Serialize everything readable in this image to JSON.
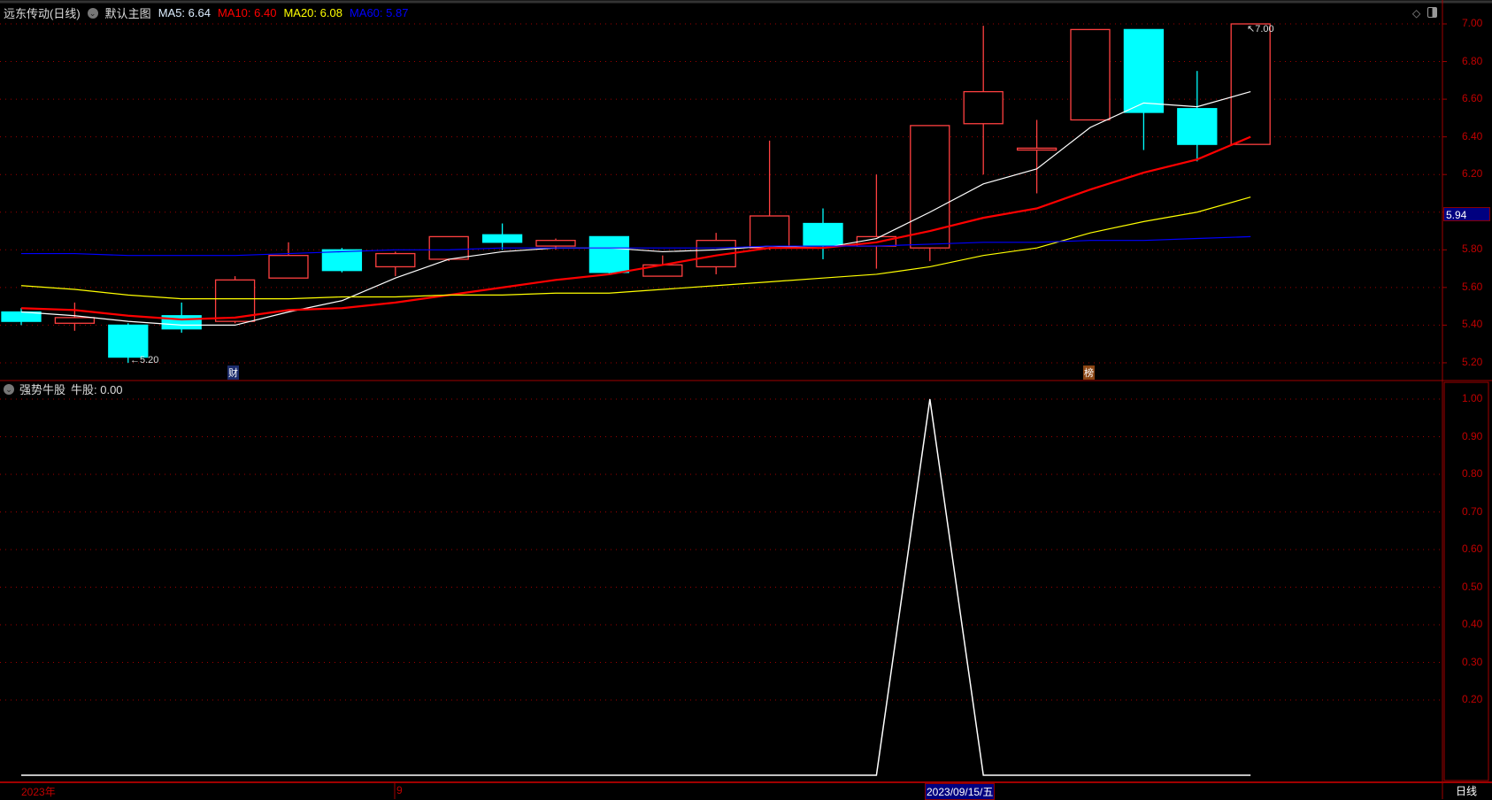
{
  "header": {
    "stock_title": "远东传动(日线)",
    "main_chart_label": "默认主图",
    "ma5": "MA5: 6.64",
    "ma10": "MA10: 6.40",
    "ma20": "MA20: 6.08",
    "ma60": "MA60: 5.87"
  },
  "indicator": {
    "name": "强势牛股",
    "value_label": "牛股: 0.00"
  },
  "colors": {
    "up": "#ff4040",
    "down": "#00ffff",
    "ma5": "#ffffff",
    "ma10": "#ff0000",
    "ma20": "#ffff00",
    "ma60": "#0000ff",
    "axis": "#c00000"
  },
  "price_axis": {
    "ticks": [
      "7.00",
      "6.80",
      "6.60",
      "6.40",
      "6.20",
      "6.00",
      "5.80",
      "5.60",
      "5.40",
      "5.20"
    ],
    "current_price": "5.94"
  },
  "indicator_axis": {
    "ticks": [
      "1.00",
      "0.90",
      "0.80",
      "0.70",
      "0.60",
      "0.50",
      "0.40",
      "0.30",
      "0.20"
    ]
  },
  "annotations": {
    "low_marker": "5.20",
    "high_marker": "7.00",
    "event_cai": "财",
    "event_bang": "榜"
  },
  "date_axis": {
    "year_label": "2023年",
    "month_label": "9",
    "selected_date": "2023/09/15/五",
    "period": "日线"
  },
  "chart_data": [
    {
      "type": "candlestick",
      "title": "远东传动(日线)",
      "ylim": [
        5.15,
        7.05
      ],
      "candles": [
        {
          "o": 5.47,
          "h": 5.49,
          "l": 5.4,
          "c": 5.42
        },
        {
          "o": 5.41,
          "h": 5.52,
          "l": 5.37,
          "c": 5.44
        },
        {
          "o": 5.4,
          "h": 5.41,
          "l": 5.2,
          "c": 5.23
        },
        {
          "o": 5.45,
          "h": 5.52,
          "l": 5.36,
          "c": 5.38
        },
        {
          "o": 5.42,
          "h": 5.66,
          "l": 5.41,
          "c": 5.64
        },
        {
          "o": 5.65,
          "h": 5.84,
          "l": 5.65,
          "c": 5.77
        },
        {
          "o": 5.8,
          "h": 5.81,
          "l": 5.68,
          "c": 5.69
        },
        {
          "o": 5.71,
          "h": 5.79,
          "l": 5.66,
          "c": 5.78
        },
        {
          "o": 5.75,
          "h": 5.87,
          "l": 5.74,
          "c": 5.87
        },
        {
          "o": 5.88,
          "h": 5.94,
          "l": 5.8,
          "c": 5.84
        },
        {
          "o": 5.82,
          "h": 5.86,
          "l": 5.8,
          "c": 5.85
        },
        {
          "o": 5.87,
          "h": 5.87,
          "l": 5.67,
          "c": 5.68
        },
        {
          "o": 5.66,
          "h": 5.77,
          "l": 5.66,
          "c": 5.72
        },
        {
          "o": 5.71,
          "h": 5.89,
          "l": 5.67,
          "c": 5.85
        },
        {
          "o": 5.81,
          "h": 6.38,
          "l": 5.8,
          "c": 5.98
        },
        {
          "o": 5.94,
          "h": 6.02,
          "l": 5.75,
          "c": 5.82
        },
        {
          "o": 5.82,
          "h": 6.2,
          "l": 5.7,
          "c": 5.87
        },
        {
          "o": 5.81,
          "h": 6.46,
          "l": 5.74,
          "c": 6.46
        },
        {
          "o": 6.47,
          "h": 6.99,
          "l": 6.2,
          "c": 6.64
        },
        {
          "o": 6.33,
          "h": 6.49,
          "l": 6.1,
          "c": 6.34
        },
        {
          "o": 6.49,
          "h": 6.97,
          "l": 6.49,
          "c": 6.97
        },
        {
          "o": 6.97,
          "h": 6.97,
          "l": 6.33,
          "c": 6.53
        },
        {
          "o": 6.55,
          "h": 6.75,
          "l": 6.27,
          "c": 6.36
        },
        {
          "o": 6.36,
          "h": 7.0,
          "l": 6.36,
          "c": 7.0
        }
      ],
      "series": [
        {
          "name": "MA5",
          "values": [
            5.47,
            5.45,
            5.42,
            5.4,
            5.4,
            5.47,
            5.53,
            5.65,
            5.75,
            5.79,
            5.81,
            5.81,
            5.79,
            5.8,
            5.82,
            5.81,
            5.86,
            6.0,
            6.15,
            6.23,
            6.45,
            6.58,
            6.56,
            6.64
          ]
        },
        {
          "name": "MA10",
          "values": [
            5.49,
            5.48,
            5.45,
            5.43,
            5.44,
            5.48,
            5.49,
            5.52,
            5.56,
            5.6,
            5.64,
            5.67,
            5.72,
            5.77,
            5.81,
            5.81,
            5.84,
            5.9,
            5.97,
            6.02,
            6.12,
            6.21,
            6.28,
            6.4
          ]
        },
        {
          "name": "MA20",
          "values": [
            5.61,
            5.59,
            5.56,
            5.54,
            5.54,
            5.54,
            5.55,
            5.55,
            5.56,
            5.56,
            5.57,
            5.57,
            5.59,
            5.61,
            5.63,
            5.65,
            5.67,
            5.71,
            5.77,
            5.81,
            5.89,
            5.95,
            6.0,
            6.08
          ]
        },
        {
          "name": "MA60",
          "values": [
            5.78,
            5.78,
            5.77,
            5.77,
            5.77,
            5.78,
            5.79,
            5.8,
            5.8,
            5.81,
            5.81,
            5.81,
            5.81,
            5.81,
            5.82,
            5.82,
            5.82,
            5.83,
            5.84,
            5.84,
            5.85,
            5.85,
            5.86,
            5.87
          ]
        }
      ]
    },
    {
      "type": "line",
      "title": "强势牛股",
      "ylim": [
        0,
        1
      ],
      "series": [
        {
          "name": "牛股",
          "values": [
            0,
            0,
            0,
            0,
            0,
            0,
            0,
            0,
            0,
            0,
            0,
            0,
            0,
            0,
            0,
            0,
            0,
            1,
            0,
            0,
            0,
            0,
            0,
            0
          ]
        }
      ]
    }
  ]
}
